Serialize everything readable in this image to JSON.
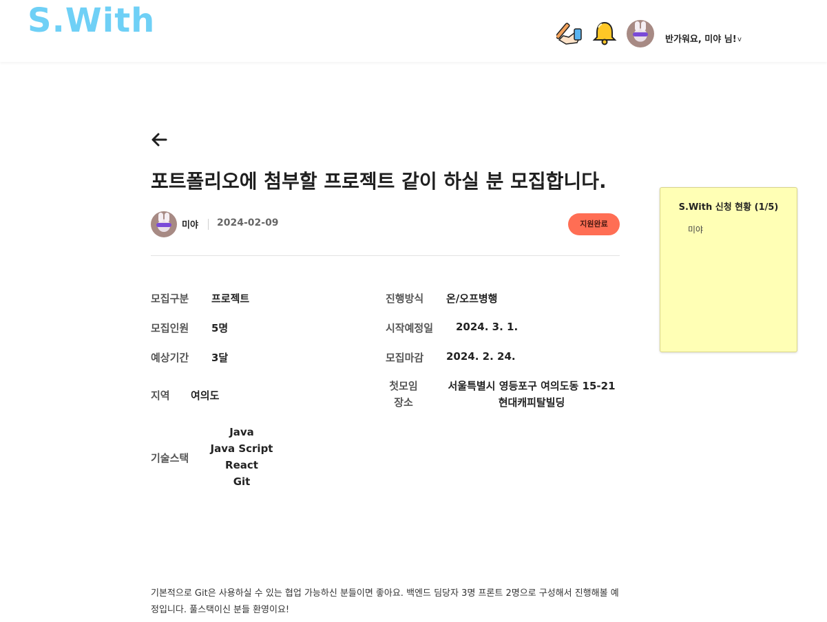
{
  "header": {
    "logo_text": "S.With",
    "logo_color": "#6fd0f6",
    "write_icon": "pencil-hand-icon",
    "notification_icon": "bell-icon",
    "greeting": "반가워요, 미야 님!",
    "greeting_caret": "v"
  },
  "post": {
    "title": "포트폴리오에 첨부할 프로젝트 같이 하실 분 모집합니다.",
    "author": "미야",
    "date": "2024-02-09",
    "status": "지원완료",
    "status_color": "#ff6e54"
  },
  "details": {
    "category_label": "모집구분",
    "category_value": "프로젝트",
    "headcount_label": "모집인원",
    "headcount_value": "5명",
    "duration_label": "예상기간",
    "duration_value": "3달",
    "region_label": "지역",
    "region_value": "여의도",
    "method_label": "진행방식",
    "method_value": "온/오프병행",
    "start_label": "시작예정일",
    "start_value": "2024. 3. 1.",
    "deadline_label": "모집마감",
    "deadline_value": "2024. 2. 24.",
    "meeting_label_1": "첫모임",
    "meeting_label_2": "장소",
    "meeting_value_1": "서울특별시 영등포구 여의도동 15-21",
    "meeting_value_2": "현대캐피탈빌딩",
    "tech_label": "기술스택",
    "tech_stack": [
      "Java",
      "Java Script",
      "React",
      "Git"
    ]
  },
  "description": "기본적으로 Git은 사용하실 수 있는 협업 가능하신 분들이면 좋아요. 백엔드 딤당자 3명 프론트 2명으로 구성해서 진행해볼 예정입니다. 풀스택이신 분들 환영이요!",
  "side_panel": {
    "title": "S.With 신청 현황 (1/5)",
    "members": [
      "미야"
    ],
    "bg_color": "#ffffb5"
  }
}
